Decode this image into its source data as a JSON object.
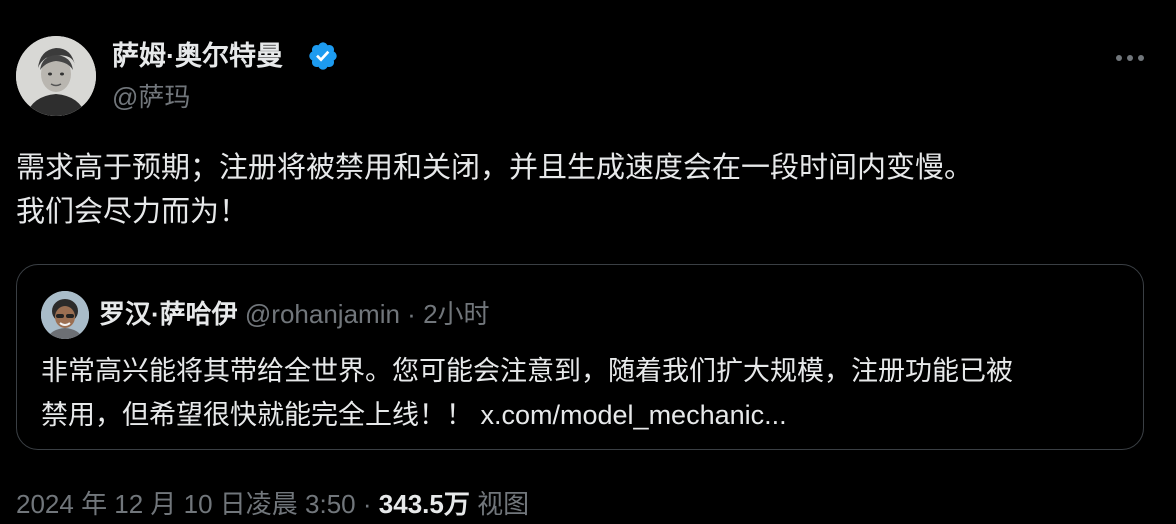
{
  "author": {
    "display_name": "萨姆·奥尔特曼",
    "handle": "@萨玛",
    "verified": true,
    "verified_color": "#1d9bf0"
  },
  "tweet": {
    "lines": [
      "需求高于预期；注册将被禁用和关闭，并且生成速度会在一段时间内变慢。",
      "我们会尽力而为！"
    ]
  },
  "quote": {
    "display_name": "罗汉·萨哈伊",
    "handle": "@rohanjamin",
    "separator": "·",
    "time": "2小时",
    "lines": [
      "非常高兴能将其带给全世界。您可能会注意到，随着我们扩大规模，注册功能已被",
      "禁用，但希望很快就能完全上线！！ x.com/model_mechanic..."
    ]
  },
  "meta": {
    "timestamp": "2024 年 12 月 10 日凌晨 3:50",
    "separator": "·",
    "views_count": "343.5万",
    "views_label": "视图"
  },
  "icons": {
    "more": "more-options-icon",
    "verified": "verified-badge-icon"
  },
  "colors": {
    "background": "#000000",
    "text_primary": "#e7e9ea",
    "text_secondary": "#71767b",
    "border": "#3a3f44"
  }
}
